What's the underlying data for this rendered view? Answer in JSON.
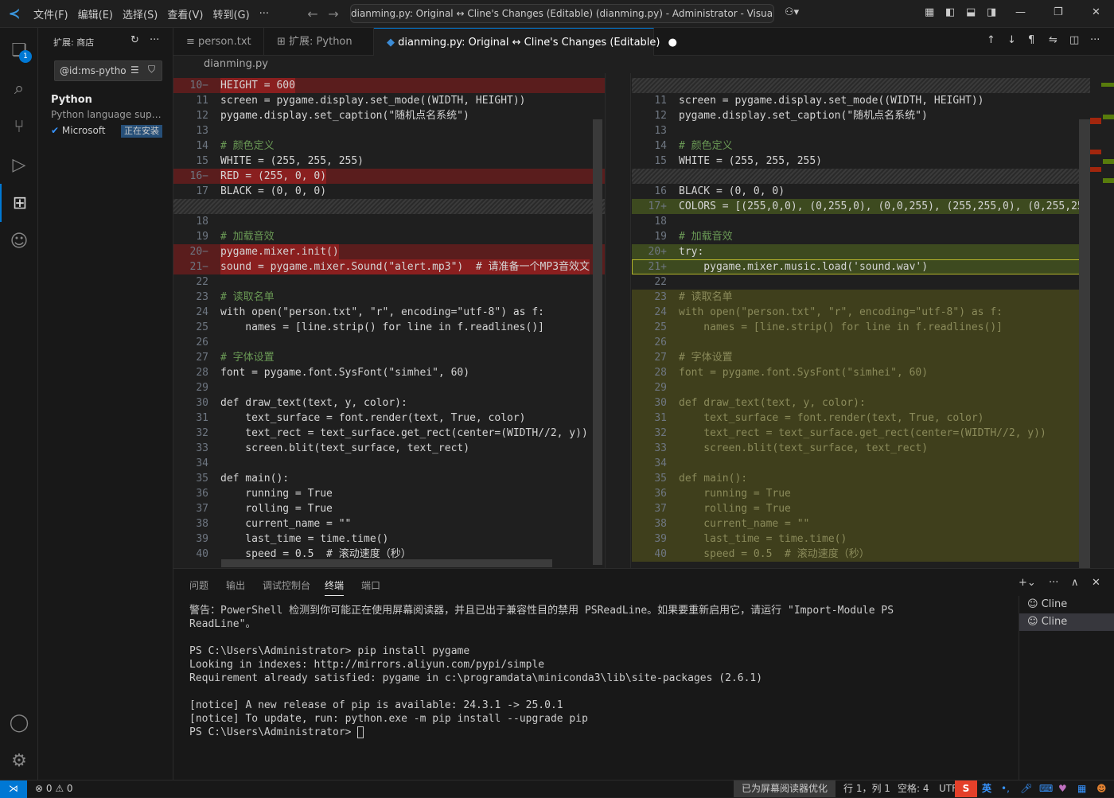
{
  "titlebar": {
    "menus": [
      "文件(F)",
      "编辑(E)",
      "选择(S)",
      "查看(V)",
      "转到(G)",
      "···"
    ],
    "command_center": "dianming.py: Original ↔ Cline's Changes (Editable) (dianming.py) - Administrator - Visual Studio Cod"
  },
  "activitybar": {
    "explorer_badge": "1"
  },
  "sidebar": {
    "title": "扩展: 商店",
    "search_value": "@id:ms-pytho",
    "extension": {
      "name": "Python",
      "description": "Python language support",
      "publisher": "Microsoft",
      "status": "正在安装"
    }
  },
  "tabs": [
    {
      "label": "person.txt",
      "icon": "≡"
    },
    {
      "label": "扩展: Python",
      "icon": "⊞"
    },
    {
      "label": "dianming.py: Original ↔ Cline's Changes (Editable)",
      "icon": "◆",
      "modified_dot": "●"
    }
  ],
  "breadcrumb": "dianming.py",
  "left_lines": [
    {
      "n": "10",
      "mark": "−",
      "kind": "del",
      "text": "HEIGHT = 600"
    },
    {
      "n": "11",
      "mark": "",
      "kind": "",
      "text": "screen = pygame.display.set_mode((WIDTH, HEIGHT))"
    },
    {
      "n": "12",
      "mark": "",
      "kind": "",
      "text": "pygame.display.set_caption(\"随机点名系统\")"
    },
    {
      "n": "13",
      "mark": "",
      "kind": "",
      "text": ""
    },
    {
      "n": "14",
      "mark": "",
      "kind": "",
      "text": "# 颜色定义"
    },
    {
      "n": "15",
      "mark": "",
      "kind": "",
      "text": "WHITE = (255, 255, 255)"
    },
    {
      "n": "16",
      "mark": "−",
      "kind": "del",
      "text": "RED = (255, 0, 0)"
    },
    {
      "n": "17",
      "mark": "",
      "kind": "",
      "text": "BLACK = (0, 0, 0)"
    },
    {
      "n": "",
      "mark": "",
      "kind": "hatch",
      "text": ""
    },
    {
      "n": "18",
      "mark": "",
      "kind": "",
      "text": ""
    },
    {
      "n": "19",
      "mark": "",
      "kind": "",
      "text": "# 加载音效"
    },
    {
      "n": "20",
      "mark": "−",
      "kind": "del",
      "text": "pygame.mixer.init()"
    },
    {
      "n": "21",
      "mark": "−",
      "kind": "del",
      "text": "sound = pygame.mixer.Sound(\"alert.mp3\")  # 请准备一个MP3音效文"
    },
    {
      "n": "22",
      "mark": "",
      "kind": "",
      "text": ""
    },
    {
      "n": "23",
      "mark": "",
      "kind": "",
      "text": "# 读取名单"
    },
    {
      "n": "24",
      "mark": "",
      "kind": "",
      "text": "with open(\"person.txt\", \"r\", encoding=\"utf-8\") as f:"
    },
    {
      "n": "25",
      "mark": "",
      "kind": "",
      "text": "    names = [line.strip() for line in f.readlines()]"
    },
    {
      "n": "26",
      "mark": "",
      "kind": "",
      "text": ""
    },
    {
      "n": "27",
      "mark": "",
      "kind": "",
      "text": "# 字体设置"
    },
    {
      "n": "28",
      "mark": "",
      "kind": "",
      "text": "font = pygame.font.SysFont(\"simhei\", 60)"
    },
    {
      "n": "29",
      "mark": "",
      "kind": "",
      "text": ""
    },
    {
      "n": "30",
      "mark": "",
      "kind": "",
      "text": "def draw_text(text, y, color):"
    },
    {
      "n": "31",
      "mark": "",
      "kind": "",
      "text": "    text_surface = font.render(text, True, color)"
    },
    {
      "n": "32",
      "mark": "",
      "kind": "",
      "text": "    text_rect = text_surface.get_rect(center=(WIDTH//2, y))"
    },
    {
      "n": "33",
      "mark": "",
      "kind": "",
      "text": "    screen.blit(text_surface, text_rect)"
    },
    {
      "n": "34",
      "mark": "",
      "kind": "",
      "text": ""
    },
    {
      "n": "35",
      "mark": "",
      "kind": "",
      "text": "def main():"
    },
    {
      "n": "36",
      "mark": "",
      "kind": "",
      "text": "    running = True"
    },
    {
      "n": "37",
      "mark": "",
      "kind": "",
      "text": "    rolling = True"
    },
    {
      "n": "38",
      "mark": "",
      "kind": "",
      "text": "    current_name = \"\""
    },
    {
      "n": "39",
      "mark": "",
      "kind": "",
      "text": "    last_time = time.time()"
    },
    {
      "n": "40",
      "mark": "",
      "kind": "",
      "text": "    speed = 0.5  # 滚动速度（秒）"
    }
  ],
  "right_lines": [
    {
      "n": "",
      "mark": "",
      "kind": "hatch",
      "text": ""
    },
    {
      "n": "11",
      "mark": "",
      "kind": "",
      "text": "screen = pygame.display.set_mode((WIDTH, HEIGHT))"
    },
    {
      "n": "12",
      "mark": "",
      "kind": "",
      "text": "pygame.display.set_caption(\"随机点名系统\")"
    },
    {
      "n": "13",
      "mark": "",
      "kind": "",
      "text": ""
    },
    {
      "n": "14",
      "mark": "",
      "kind": "",
      "text": "# 颜色定义"
    },
    {
      "n": "15",
      "mark": "",
      "kind": "",
      "text": "WHITE = (255, 255, 255)"
    },
    {
      "n": "",
      "mark": "",
      "kind": "hatch",
      "text": ""
    },
    {
      "n": "16",
      "mark": "",
      "kind": "",
      "text": "BLACK = (0, 0, 0)"
    },
    {
      "n": "17",
      "mark": "+",
      "kind": "add",
      "text": "COLORS = [(255,0,0), (0,255,0), (0,0,255), (255,255,0), (0,255,25"
    },
    {
      "n": "18",
      "mark": "",
      "kind": "",
      "text": ""
    },
    {
      "n": "19",
      "mark": "",
      "kind": "",
      "text": "# 加载音效"
    },
    {
      "n": "20",
      "mark": "+",
      "kind": "add",
      "text": "try:"
    },
    {
      "n": "21",
      "mark": "+",
      "kind": "add-cur",
      "text": "    pygame.mixer.music.load('sound.wav')"
    },
    {
      "n": "22",
      "mark": "",
      "kind": "",
      "text": ""
    },
    {
      "n": "23",
      "mark": "",
      "kind": "grey",
      "text": "# 读取名单"
    },
    {
      "n": "24",
      "mark": "",
      "kind": "grey",
      "text": "with open(\"person.txt\", \"r\", encoding=\"utf-8\") as f:"
    },
    {
      "n": "25",
      "mark": "",
      "kind": "grey",
      "text": "    names = [line.strip() for line in f.readlines()]"
    },
    {
      "n": "26",
      "mark": "",
      "kind": "grey",
      "text": ""
    },
    {
      "n": "27",
      "mark": "",
      "kind": "grey",
      "text": "# 字体设置"
    },
    {
      "n": "28",
      "mark": "",
      "kind": "grey",
      "text": "font = pygame.font.SysFont(\"simhei\", 60)"
    },
    {
      "n": "29",
      "mark": "",
      "kind": "grey",
      "text": ""
    },
    {
      "n": "30",
      "mark": "",
      "kind": "grey",
      "text": "def draw_text(text, y, color):"
    },
    {
      "n": "31",
      "mark": "",
      "kind": "grey",
      "text": "    text_surface = font.render(text, True, color)"
    },
    {
      "n": "32",
      "mark": "",
      "kind": "grey",
      "text": "    text_rect = text_surface.get_rect(center=(WIDTH//2, y))"
    },
    {
      "n": "33",
      "mark": "",
      "kind": "grey",
      "text": "    screen.blit(text_surface, text_rect)"
    },
    {
      "n": "34",
      "mark": "",
      "kind": "grey",
      "text": ""
    },
    {
      "n": "35",
      "mark": "",
      "kind": "grey",
      "text": "def main():"
    },
    {
      "n": "36",
      "mark": "",
      "kind": "grey",
      "text": "    running = True"
    },
    {
      "n": "37",
      "mark": "",
      "kind": "grey",
      "text": "    rolling = True"
    },
    {
      "n": "38",
      "mark": "",
      "kind": "grey",
      "text": "    current_name = \"\""
    },
    {
      "n": "39",
      "mark": "",
      "kind": "grey",
      "text": "    last_time = time.time()"
    },
    {
      "n": "40",
      "mark": "",
      "kind": "grey",
      "text": "    speed = 0.5  # 滚动速度（秒）"
    }
  ],
  "panel": {
    "tabs": [
      "问题",
      "输出",
      "调试控制台",
      "终端",
      "端口"
    ],
    "active_tab": "终端",
    "terminal_text": "警告：PowerShell 检测到你可能正在使用屏幕阅读器，并且已出于兼容性目的禁用 PSReadLine。如果要重新启用它，请运行 \"Import-Module PS\nReadLine\"。\n\nPS C:\\Users\\Administrator> pip install pygame\nLooking in indexes: http://mirrors.aliyun.com/pypi/simple\nRequirement already satisfied: pygame in c:\\programdata\\miniconda3\\lib\\site-packages (2.6.1)\n\n[notice] A new release of pip is available: 24.3.1 -> 25.0.1\n[notice] To update, run: python.exe -m pip install --upgrade pip\nPS C:\\Users\\Administrator> ",
    "terminals": [
      "Cline",
      "Cline"
    ]
  },
  "statusbar": {
    "problems": "⊗ 0 ⚠ 0",
    "screen_reader": "已为屏幕阅读器优化",
    "position": "行 1，列 1",
    "spaces": "空格: 4",
    "encoding": "UTF",
    "ime": "英"
  },
  "colors": {
    "accent": "#0078d4",
    "deleted": "#5a1d1d",
    "added": "#3d4a1f"
  }
}
